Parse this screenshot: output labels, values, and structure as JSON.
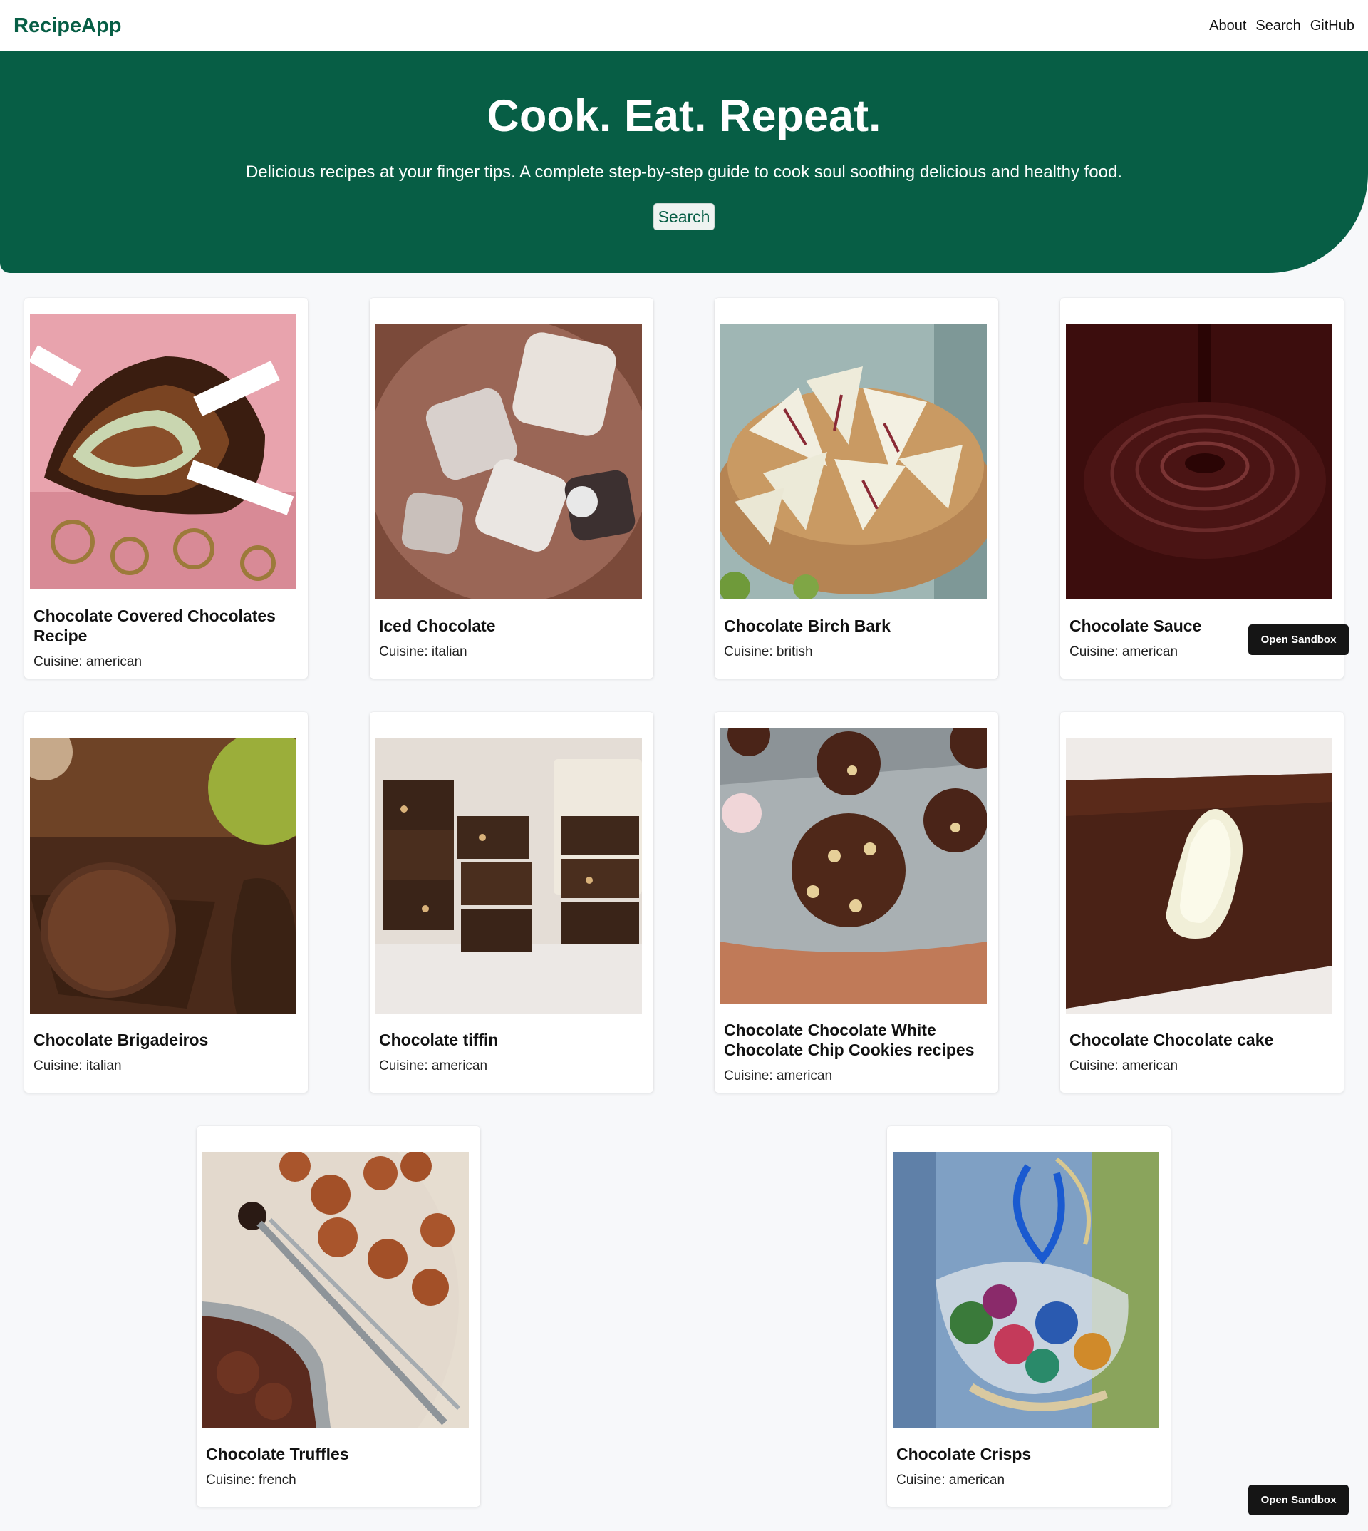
{
  "navbar": {
    "brand": "RecipeApp",
    "links": [
      "About",
      "Search",
      "GitHub"
    ]
  },
  "hero": {
    "title": "Cook. Eat. Repeat.",
    "subtitle": "Delicious recipes at your finger tips. A complete step-by-step guide to cook soul soothing delicious and healthy food.",
    "search_button": "Search"
  },
  "recipes": [
    {
      "title": "Chocolate Covered Chocolates Recipe",
      "cuisine": "Cuisine: american"
    },
    {
      "title": "Iced Chocolate",
      "cuisine": "Cuisine: italian"
    },
    {
      "title": "Chocolate Birch Bark",
      "cuisine": "Cuisine: british"
    },
    {
      "title": "Chocolate Sauce",
      "cuisine": "Cuisine: american"
    },
    {
      "title": "Chocolate Brigadeiros",
      "cuisine": "Cuisine: italian"
    },
    {
      "title": "Chocolate tiffin",
      "cuisine": "Cuisine: american"
    },
    {
      "title": "Chocolate Chocolate White Chocolate Chip Cookies recipes",
      "cuisine": "Cuisine: american"
    },
    {
      "title": "Chocolate Chocolate cake",
      "cuisine": "Cuisine: american"
    },
    {
      "title": "Chocolate Truffles",
      "cuisine": "Cuisine: french"
    },
    {
      "title": "Chocolate Crisps",
      "cuisine": "Cuisine: american"
    }
  ],
  "sandbox_button": "Open Sandbox",
  "colors": {
    "brand": "#075e45",
    "page_background": "#f7f8fa",
    "sandbox_button": "#151515"
  }
}
